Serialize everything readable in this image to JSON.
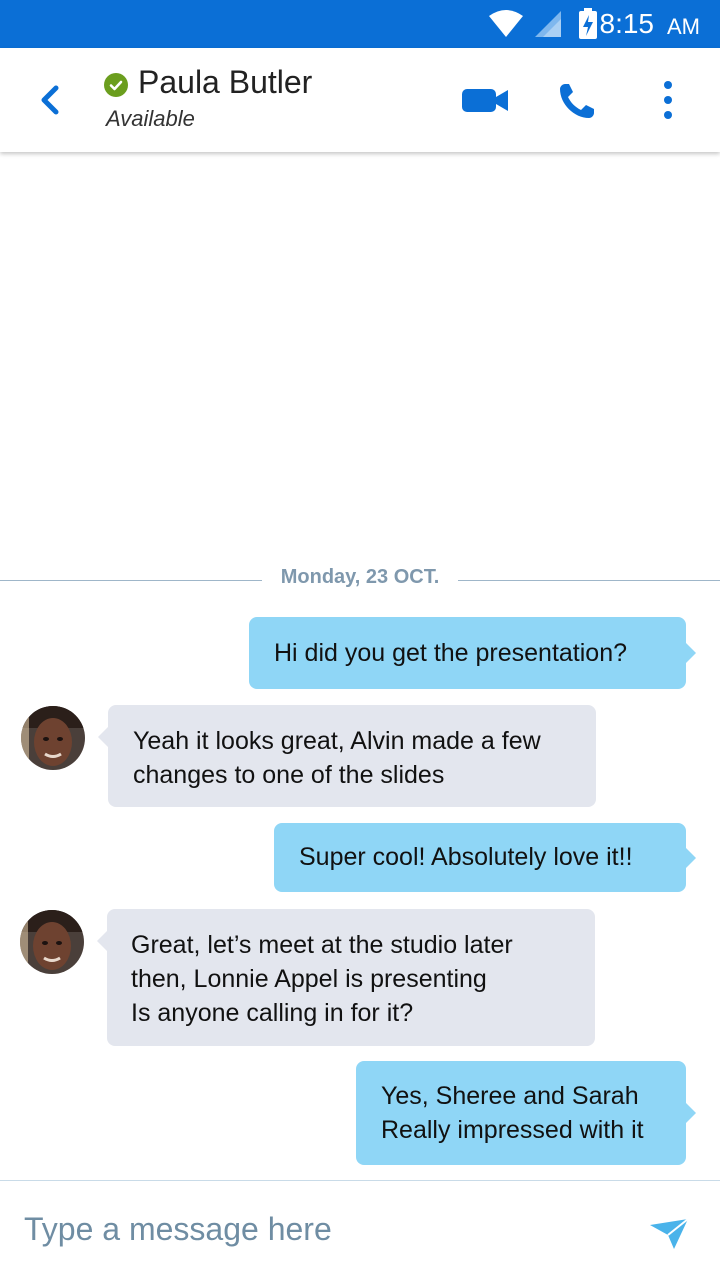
{
  "status_bar": {
    "time": "8:15",
    "ampm": "AM"
  },
  "header": {
    "contact_name": "Paula Butler",
    "presence": "Available"
  },
  "icons": {
    "back": "chevron-left-icon",
    "video": "video-camera-icon",
    "call": "phone-icon",
    "more": "more-vertical-icon",
    "send": "send-icon"
  },
  "colors": {
    "status_bar": "#0b6fd6",
    "accent": "#0b6fd6",
    "outgoing_bubble": "#8fd6f6",
    "incoming_bubble": "#e3e6ee",
    "presence_available": "#6b9e1e"
  },
  "conversation": {
    "date_separator": "Monday, 23 OCT.",
    "messages": [
      {
        "direction": "outgoing",
        "lines": [
          "Hi did you get the presentation?"
        ]
      },
      {
        "direction": "incoming",
        "lines": [
          "Yeah it looks great, Alvin made a few",
          "changes to one of the slides"
        ]
      },
      {
        "direction": "outgoing",
        "lines": [
          "Super cool! Absolutely love it!!"
        ]
      },
      {
        "direction": "incoming",
        "lines": [
          "Great, let’s meet at the studio later",
          "then, Lonnie Appel is presenting",
          "Is anyone calling in for it?"
        ]
      },
      {
        "direction": "outgoing",
        "lines": [
          "Yes, Sheree and Sarah",
          "Really impressed with it"
        ]
      }
    ]
  },
  "composer": {
    "placeholder": "Type a message here",
    "value": ""
  }
}
